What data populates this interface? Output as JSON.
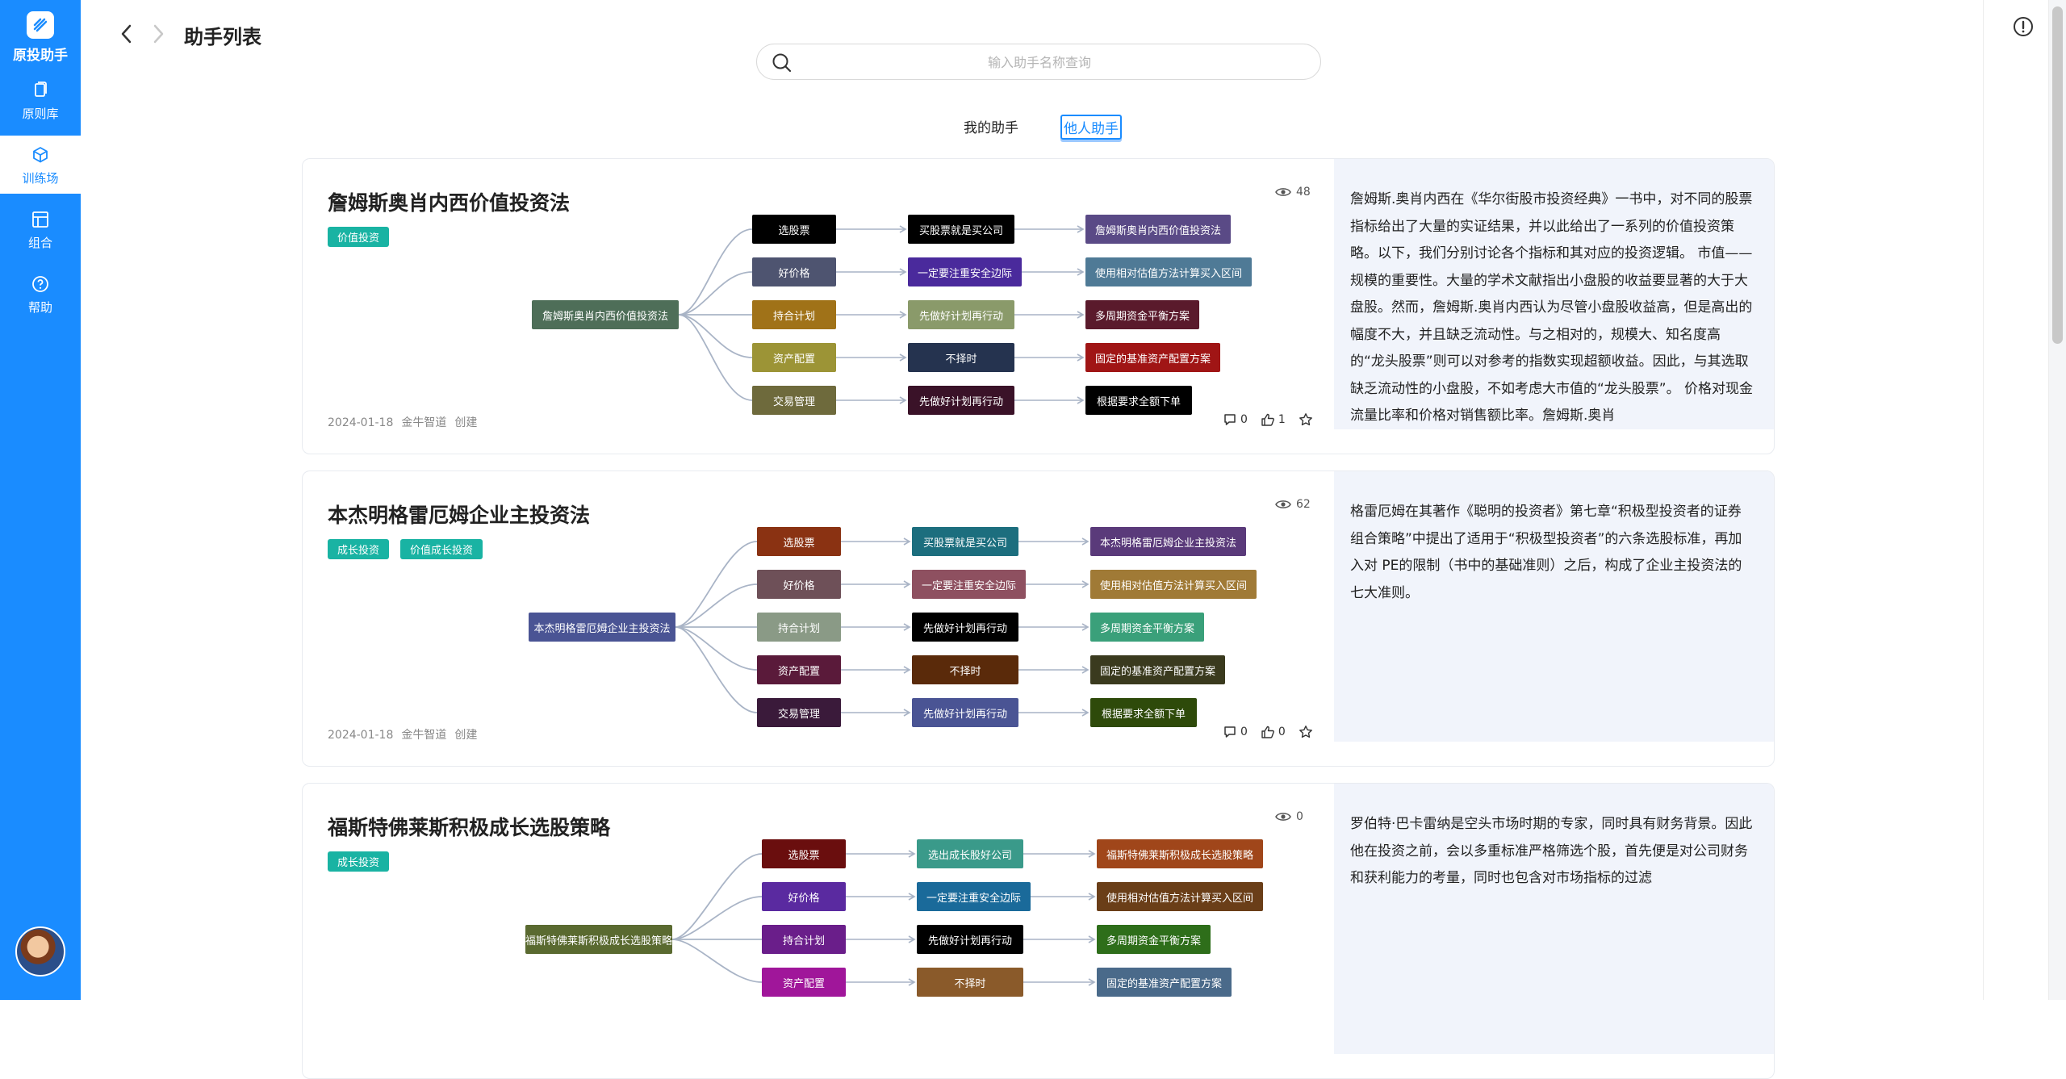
{
  "app": {
    "name": "原投助手",
    "logo_icon": "logo-icon"
  },
  "sidebar": {
    "items": [
      {
        "label": "原则库",
        "icon": "book-icon",
        "active": false
      },
      {
        "label": "训练场",
        "icon": "cube-icon",
        "active": true
      },
      {
        "label": "组合",
        "icon": "layout-icon",
        "active": false
      },
      {
        "label": "帮助",
        "icon": "help-icon",
        "active": false
      }
    ],
    "accent": "#1a8cff"
  },
  "header": {
    "title": "助手列表"
  },
  "search": {
    "placeholder": "输入助手名称查询",
    "value": ""
  },
  "tabs": [
    {
      "label": "我的助手",
      "active": false
    },
    {
      "label": "他人助手",
      "active": true
    }
  ],
  "cards": [
    {
      "title": "詹姆斯奥肖内西价值投资法",
      "tags": [
        "价值投资"
      ],
      "views": "48",
      "date": "2024-01-18",
      "author": "金牛智道",
      "action": "创建",
      "comments": "0",
      "likes": "1",
      "description": "詹姆斯.奥肖内西在《华尔街股市投资经典》一书中，对不同的股票指标给出了大量的实证结果，并以此给出了一系列的价值投资策略。以下，我们分别讨论各个指标和其对应的投资逻辑。 市值——规模的重要性。大量的学术文献指出小盘股的收益要显著的大于大盘股。然而，詹姆斯.奥肖内西认为尽管小盘股收益高，但是高出的幅度不大，并且缺乏流动性。与之相对的，规模大、知名度高的“龙头股票”则可以对参考的指数实现超额收益。因此，与其选取缺乏流动性的小盘股，不如考虑大市值的“龙头股票”。 价格对现金流量比率和价格对销售额比率。詹姆斯.奥肖",
      "mindmap": {
        "root": {
          "label": "詹姆斯奥肖内西价值投资法",
          "color": "#4e6e58"
        },
        "branches": [
          {
            "level1": {
              "label": "选股票",
              "color": "#000000"
            },
            "level2": {
              "label": "买股票就是买公司",
              "color": "#000000"
            },
            "level3": {
              "label": "詹姆斯奥肖内西价值投资法",
              "color": "#5a4a86"
            }
          },
          {
            "level1": {
              "label": "好价格",
              "color": "#4e5470"
            },
            "level2": {
              "label": "一定要注重安全边际",
              "color": "#4a2a9c"
            },
            "level3": {
              "label": "使用相对估值方法计算买入区间",
              "color": "#4f7a96"
            }
          },
          {
            "level1": {
              "label": "持合计划",
              "color": "#a07218"
            },
            "level2": {
              "label": "先做好计划再行动",
              "color": "#8a9a6a"
            },
            "level3": {
              "label": "多周期资金平衡方案",
              "color": "#5a1a2c"
            }
          },
          {
            "level1": {
              "label": "资产配置",
              "color": "#9c9436"
            },
            "level2": {
              "label": "不择时",
              "color": "#25334f"
            },
            "level3": {
              "label": "固定的基准资产配置方案",
              "color": "#a01515"
            }
          },
          {
            "level1": {
              "label": "交易管理",
              "color": "#6e6a3c"
            },
            "level2": {
              "label": "先做好计划再行动",
              "color": "#3a1228"
            },
            "level3": {
              "label": "根据要求全额下单",
              "color": "#000000"
            }
          }
        ]
      }
    },
    {
      "title": "本杰明格雷厄姆企业主投资法",
      "tags": [
        "成长投资",
        "价值成长投资"
      ],
      "views": "62",
      "date": "2024-01-18",
      "author": "金牛智道",
      "action": "创建",
      "comments": "0",
      "likes": "0",
      "description": "格雷厄姆在其著作《聪明的投资者》第七章“积极型投资者的证券组合策略”中提出了适用于“积极型投资者”的六条选股标准，再加入对 PE的限制（书中的基础准则）之后，构成了企业主投资法的七大准则。",
      "mindmap": {
        "root": {
          "label": "本杰明格雷厄姆企业主投资法",
          "color": "#4a5494"
        },
        "branches": [
          {
            "level1": {
              "label": "选股票",
              "color": "#8a3212"
            },
            "level2": {
              "label": "买股票就是买公司",
              "color": "#1c6e7e"
            },
            "level3": {
              "label": "本杰明格雷厄姆企业主投资法",
              "color": "#5a3a7a"
            }
          },
          {
            "level1": {
              "label": "好价格",
              "color": "#6e5058"
            },
            "level2": {
              "label": "一定要注重安全边际",
              "color": "#8e5060"
            },
            "level3": {
              "label": "使用相对估值方法计算买入区间",
              "color": "#a07a36"
            }
          },
          {
            "level1": {
              "label": "持合计划",
              "color": "#8a9a86"
            },
            "level2": {
              "label": "先做好计划再行动",
              "color": "#000000"
            },
            "level3": {
              "label": "多周期资金平衡方案",
              "color": "#3aa07a"
            }
          },
          {
            "level1": {
              "label": "资产配置",
              "color": "#5a1a3a"
            },
            "level2": {
              "label": "不择时",
              "color": "#5a2a0a"
            },
            "level3": {
              "label": "固定的基准资产配置方案",
              "color": "#3a3a1e"
            }
          },
          {
            "level1": {
              "label": "交易管理",
              "color": "#3a1a3a"
            },
            "level2": {
              "label": "先做好计划再行动",
              "color": "#4a5494"
            },
            "level3": {
              "label": "根据要求全额下单",
              "color": "#2e4a0a"
            }
          }
        ]
      }
    },
    {
      "title": "福斯特佛莱斯积极成长选股策略",
      "tags": [
        "成长投资"
      ],
      "views": "0",
      "date": "",
      "author": "",
      "action": "",
      "comments": "",
      "likes": "",
      "description": "罗伯特·巴卡雷纳是空头市场时期的专家，同时具有财务背景。因此他在投资之前，会以多重标准严格筛选个股，首先便是对公司财务和获利能力的考量，同时也包含对市场指标的过滤",
      "mindmap": {
        "root": {
          "label": "福斯特佛莱斯积极成长选股策略",
          "color": "#5a6a30"
        },
        "branches": [
          {
            "level1": {
              "label": "选股票",
              "color": "#6a0e0e"
            },
            "level2": {
              "label": "选出成长股好公司",
              "color": "#3a9a8a"
            },
            "level3": {
              "label": "福斯特佛莱斯积极成长选股策略",
              "color": "#a0461a"
            }
          },
          {
            "level1": {
              "label": "好价格",
              "color": "#5a2aa0"
            },
            "level2": {
              "label": "一定要注重安全边际",
              "color": "#1a6a9a"
            },
            "level3": {
              "label": "使用相对估值方法计算买入区间",
              "color": "#6a3e18"
            }
          },
          {
            "level1": {
              "label": "持合计划",
              "color": "#6a1e8a"
            },
            "level2": {
              "label": "先做好计划再行动",
              "color": "#000000"
            },
            "level3": {
              "label": "多周期资金平衡方案",
              "color": "#2e6e1a"
            }
          },
          {
            "level1": {
              "label": "资产配置",
              "color": "#a0169a"
            },
            "level2": {
              "label": "不择时",
              "color": "#8a5a2a"
            },
            "level3": {
              "label": "固定的基准资产配置方案",
              "color": "#4a6a8a"
            }
          }
        ]
      }
    }
  ]
}
